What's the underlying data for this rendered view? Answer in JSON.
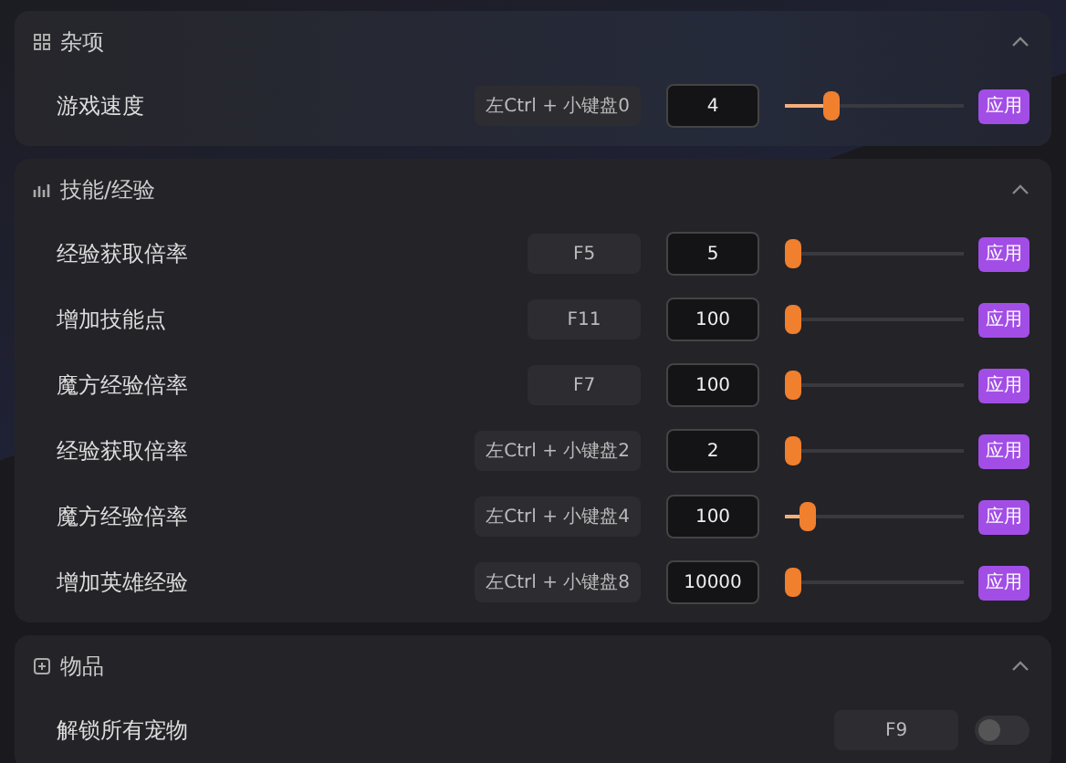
{
  "sections": [
    {
      "title": "杂项",
      "expanded": true,
      "rows": [
        {
          "kind": "slider",
          "label": "游戏速度",
          "hotkey": "左Ctrl + 小键盘0",
          "value": "4",
          "level": 0.24,
          "button": "应用"
        }
      ]
    },
    {
      "title": "技能/经验",
      "expanded": true,
      "rows": [
        {
          "kind": "slider",
          "label": "经验获取倍率",
          "hotkey": "F5",
          "value": "5",
          "level": 0,
          "button": "应用"
        },
        {
          "kind": "slider",
          "label": "增加技能点",
          "hotkey": "F11",
          "value": "100",
          "level": 0,
          "button": "应用"
        },
        {
          "kind": "slider",
          "label": "魔方经验倍率",
          "hotkey": "F7",
          "value": "100",
          "level": 0,
          "button": "应用"
        },
        {
          "kind": "slider",
          "label": "经验获取倍率",
          "hotkey": "左Ctrl + 小键盘2",
          "value": "2",
          "level": 0,
          "button": "应用"
        },
        {
          "kind": "slider",
          "label": "魔方经验倍率",
          "hotkey": "左Ctrl + 小键盘4",
          "value": "100",
          "level": 0.09,
          "button": "应用"
        },
        {
          "kind": "slider",
          "label": "增加英雄经验",
          "hotkey": "左Ctrl + 小键盘8",
          "value": "10000",
          "level": 0,
          "button": "应用"
        }
      ]
    },
    {
      "title": "物品",
      "expanded": true,
      "rows": [
        {
          "kind": "toggle",
          "label": "解锁所有宠物",
          "hotkey": "F9",
          "on": false
        }
      ]
    }
  ]
}
